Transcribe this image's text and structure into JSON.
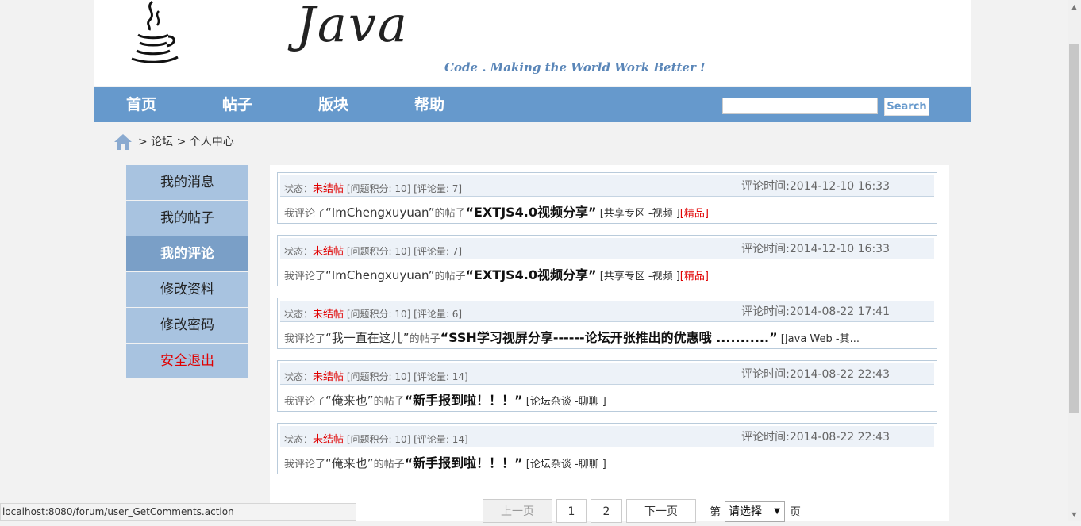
{
  "header": {
    "logo_text": "Java",
    "slogan": "Code . Making the World Work Better !"
  },
  "nav": {
    "items": [
      "首页",
      "帖子",
      "版块",
      "帮助"
    ],
    "search_value": "",
    "search_label": "Search"
  },
  "breadcrumb": {
    "text": "> 论坛 > 个人中心"
  },
  "sidebar": {
    "items": [
      "我的消息",
      "我的帖子",
      "我的评论",
      "修改资料",
      "修改密码",
      "安全退出"
    ],
    "active": "我的评论"
  },
  "comments": [
    {
      "status_label": "状态：",
      "status": "未结帖",
      "meta": "[问题积分: 10] [评论量: 7]",
      "time": "评论时间:2014-12-10 16:33",
      "prefix": "我评论了",
      "author": "“ImChengxuyuan”",
      "mid": "的帖子",
      "title": "“EXTJS4.0视频分享”",
      "board": "[共享专区 -视频 ]",
      "tag": "[精品]"
    },
    {
      "status_label": "状态：",
      "status": "未结帖",
      "meta": "[问题积分: 10] [评论量: 7]",
      "time": "评论时间:2014-12-10 16:33",
      "prefix": "我评论了",
      "author": "“ImChengxuyuan”",
      "mid": "的帖子",
      "title": "“EXTJS4.0视频分享”",
      "board": "[共享专区 -视频 ]",
      "tag": "[精品]"
    },
    {
      "status_label": "状态：",
      "status": "未结帖",
      "meta": "[问题积分: 10] [评论量: 6]",
      "time": "评论时间:2014-08-22 17:41",
      "prefix": "我评论了",
      "author": "“我一直在这儿”",
      "mid": "的帖子",
      "title": "“SSH学习视屏分享------论坛开张推出的优惠哦 ...........”",
      "board": "[Java Web -其...",
      "tag": ""
    },
    {
      "status_label": "状态：",
      "status": "未结帖",
      "meta": "[问题积分: 10] [评论量: 14]",
      "time": "评论时间:2014-08-22 22:43",
      "prefix": "我评论了",
      "author": "“俺来也”",
      "mid": "的帖子",
      "title": "“新手报到啦！！！”",
      "board": "[论坛杂谈 -聊聊 ]",
      "tag": ""
    },
    {
      "status_label": "状态：",
      "status": "未结帖",
      "meta": "[问题积分: 10] [评论量: 14]",
      "time": "评论时间:2014-08-22 22:43",
      "prefix": "我评论了",
      "author": "“俺来也”",
      "mid": "的帖子",
      "title": "“新手报到啦！！！”",
      "board": "[论坛杂谈 -聊聊 ]",
      "tag": ""
    }
  ],
  "pager": {
    "prev": "上一页",
    "pages": [
      "1",
      "2"
    ],
    "next": "下一页",
    "goto_prefix": "第",
    "select_value": "请选择",
    "goto_suffix": "页"
  },
  "statusbar": {
    "url": "localhost:8080/forum/user_GetComments.action"
  }
}
